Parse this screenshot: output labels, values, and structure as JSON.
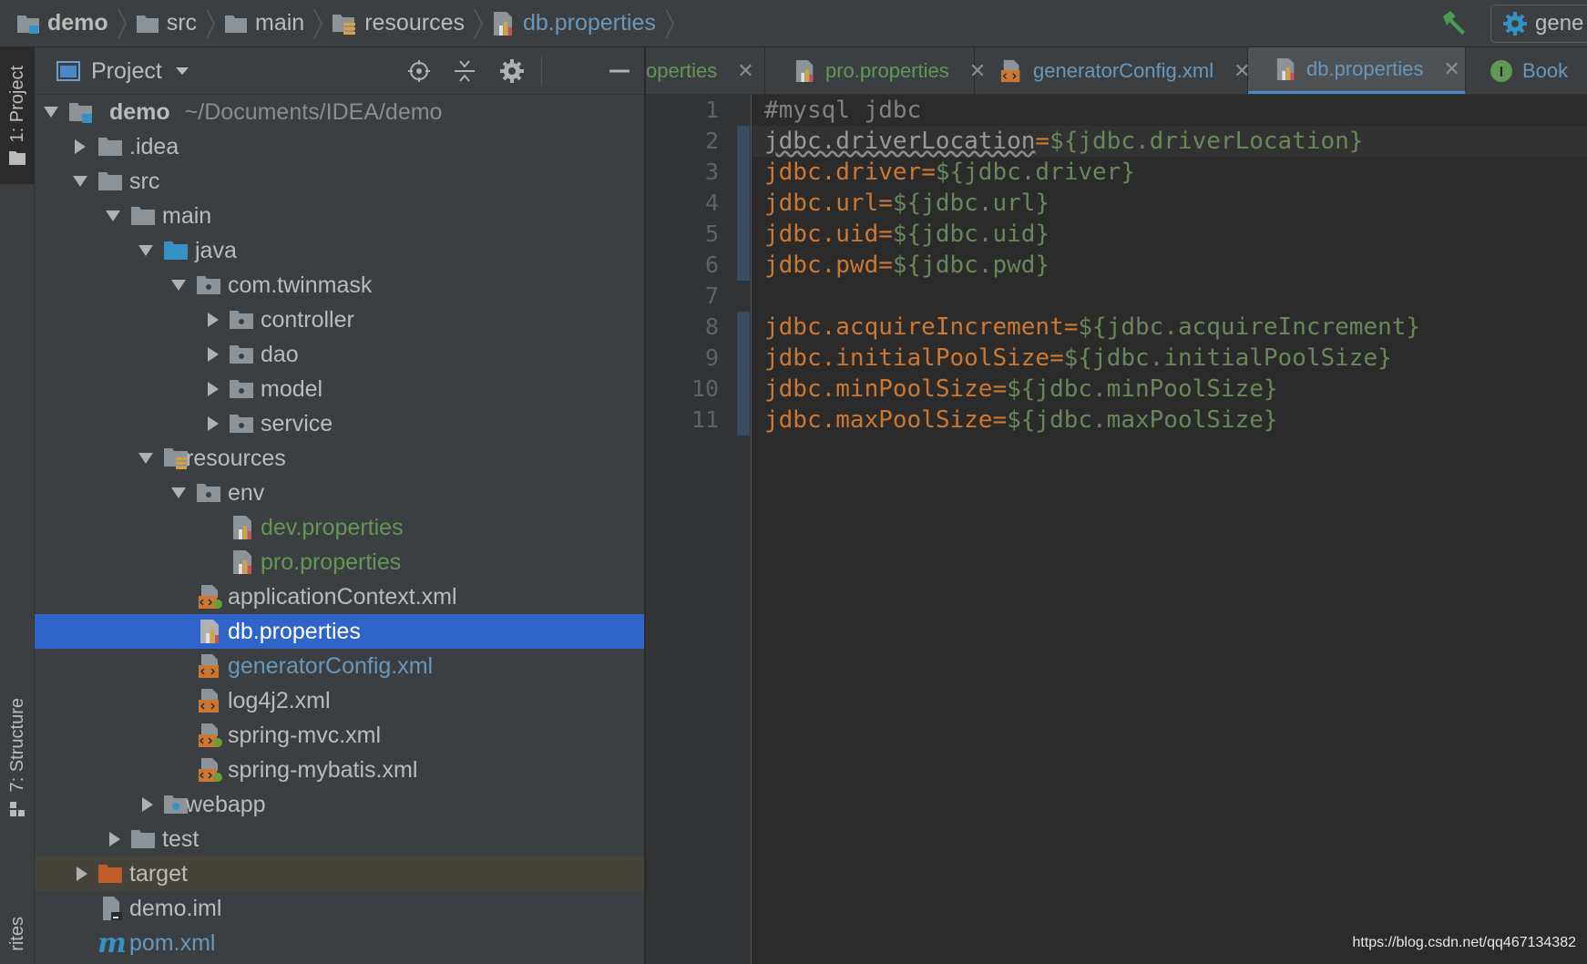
{
  "breadcrumbs": [
    {
      "label": "demo",
      "icon": "module-folder-icon"
    },
    {
      "label": "src",
      "icon": "folder-icon"
    },
    {
      "label": "main",
      "icon": "folder-icon"
    },
    {
      "label": "resources",
      "icon": "resources-folder-icon"
    },
    {
      "label": "db.properties",
      "icon": "properties-file-icon"
    }
  ],
  "toolbar": {
    "run_config_label": "gene"
  },
  "side_tabs": {
    "project": "1: Project",
    "structure": "7: Structure",
    "favorites": "rites"
  },
  "project_panel": {
    "title": "Project"
  },
  "tree": {
    "root_name": "demo",
    "root_path": "~/Documents/IDEA/demo",
    "idea": ".idea",
    "src": "src",
    "main": "main",
    "java": "java",
    "package": "com.twinmask",
    "controller": "controller",
    "dao": "dao",
    "model": "model",
    "service": "service",
    "resources": "resources",
    "env": "env",
    "dev_properties": "dev.properties",
    "pro_properties": "pro.properties",
    "application_context": "applicationContext.xml",
    "db_properties": "db.properties",
    "generator_config": "generatorConfig.xml",
    "log4j2": "log4j2.xml",
    "spring_mvc": "spring-mvc.xml",
    "spring_mybatis": "spring-mybatis.xml",
    "webapp": "webapp",
    "test": "test",
    "target": "target",
    "demo_iml": "demo.iml",
    "pom": "pom.xml"
  },
  "tabs": [
    {
      "label": "operties"
    },
    {
      "label": "pro.properties"
    },
    {
      "label": "generatorConfig.xml"
    },
    {
      "label": "db.properties",
      "active": true
    },
    {
      "label": "Book"
    }
  ],
  "editor": {
    "lines": [
      {
        "n": "1",
        "comment": "#mysql jdbc"
      },
      {
        "n": "2",
        "key": "jdbc.driverLocation",
        "eq": "=",
        "val": "${jdbc.driverLocation}"
      },
      {
        "n": "3",
        "key": "jdbc.driver",
        "eq": "=",
        "val": "${jdbc.driver}"
      },
      {
        "n": "4",
        "key": "jdbc.url",
        "eq": "=",
        "val": "${jdbc.url}"
      },
      {
        "n": "5",
        "key": "jdbc.uid",
        "eq": "=",
        "val": "${jdbc.uid}"
      },
      {
        "n": "6",
        "key": "jdbc.pwd",
        "eq": "=",
        "val": "${jdbc.pwd}"
      },
      {
        "n": "7"
      },
      {
        "n": "8",
        "key": "jdbc.acquireIncrement",
        "eq": "=",
        "val": "${jdbc.acquireIncrement}"
      },
      {
        "n": "9",
        "key": "jdbc.initialPoolSize",
        "eq": "=",
        "val": "${jdbc.initialPoolSize}"
      },
      {
        "n": "10",
        "key": "jdbc.minPoolSize",
        "eq": "=",
        "val": "${jdbc.minPoolSize}"
      },
      {
        "n": "11",
        "key": "jdbc.maxPoolSize",
        "eq": "=",
        "val": "${jdbc.maxPoolSize}"
      }
    ]
  },
  "watermark": "https://blog.csdn.net/qq467134382",
  "colors": {
    "selection": "#2f65ca",
    "keyword": "#cc7832",
    "value": "#6a8759",
    "vcs_green": "#629755",
    "vcs_blue": "#6897bb"
  }
}
